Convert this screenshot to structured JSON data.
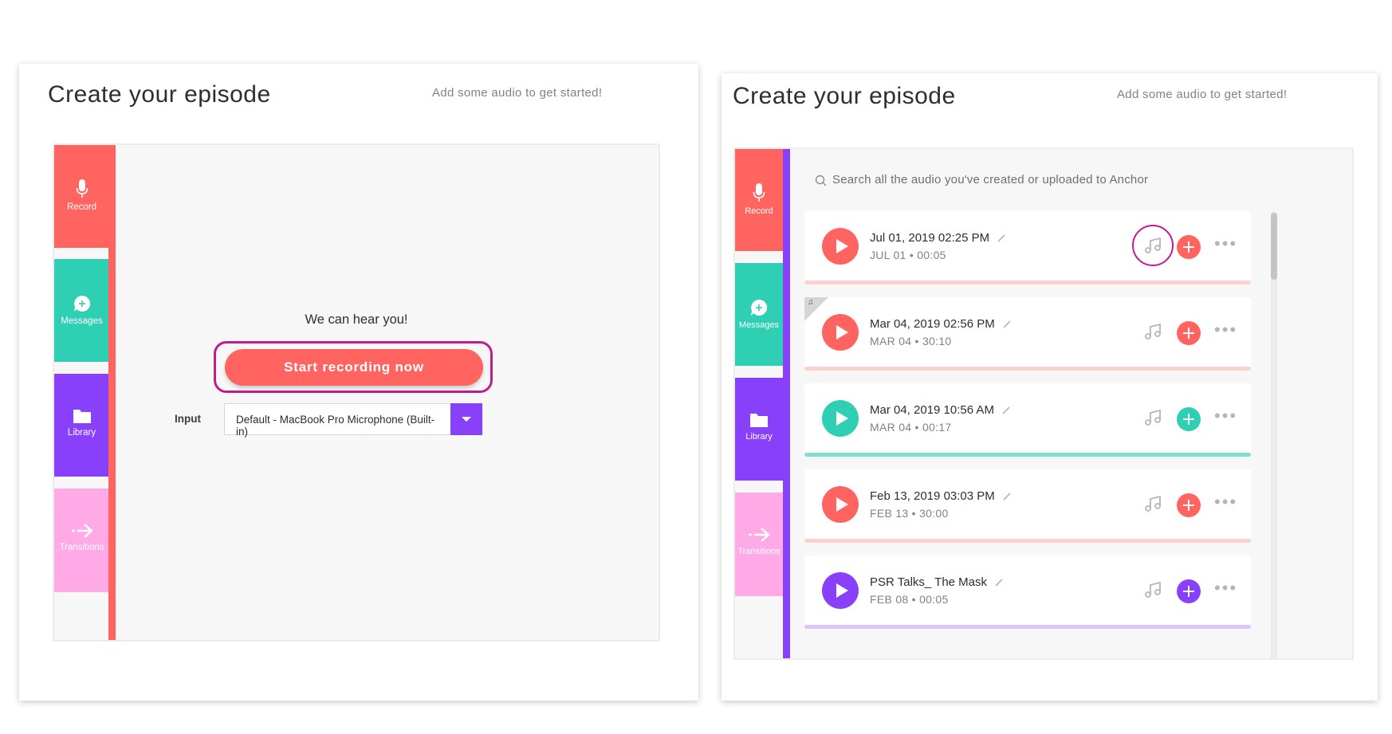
{
  "left_panel": {
    "title": "Create your episode",
    "subtitle": "Add some audio to get started!",
    "tabs": [
      {
        "label": "Record",
        "icon": "microphone-icon"
      },
      {
        "label": "Messages",
        "icon": "chat-plus-icon"
      },
      {
        "label": "Library",
        "icon": "folder-icon"
      },
      {
        "label": "Transitions",
        "icon": "arrow-right-icon"
      }
    ],
    "status_text": "We can hear you!",
    "record_button": "Start recording now",
    "input_label": "Input",
    "input_value": "Default - MacBook Pro Microphone (Built-in)"
  },
  "right_panel": {
    "title": "Create your episode",
    "subtitle": "Add some audio to get started!",
    "tabs": [
      {
        "label": "Record",
        "icon": "microphone-icon"
      },
      {
        "label": "Messages",
        "icon": "chat-plus-icon"
      },
      {
        "label": "Library",
        "icon": "folder-icon"
      },
      {
        "label": "Transitions",
        "icon": "arrow-right-icon"
      }
    ],
    "search_placeholder": "Search all the audio you've created or uploaded to Anchor",
    "items": [
      {
        "title": "Jul 01, 2019 02:25 PM",
        "meta": "JUL 01 • 00:05",
        "color": "#ff6461",
        "bar_color": "#fbd0cf"
      },
      {
        "title": "Mar 04, 2019 02:56 PM",
        "meta": "MAR 04 • 30:10",
        "color": "#ff6461",
        "bar_color": "#fbd0cf"
      },
      {
        "title": "Mar 04, 2019 10:56 AM",
        "meta": "MAR 04 • 00:17",
        "color": "#2ecfb3",
        "bar_color": "#7fdfcd"
      },
      {
        "title": "Feb 13, 2019 03:03 PM",
        "meta": "FEB 13 • 30:00",
        "color": "#ff6461",
        "bar_color": "#fbd0cf"
      },
      {
        "title": "PSR Talks_ The Mask",
        "meta": "FEB 08 • 00:05",
        "color": "#8940fa",
        "bar_color": "#d9c4fd"
      }
    ]
  },
  "colors": {
    "record": "#ff6461",
    "messages": "#2ecfb3",
    "library": "#8940fa",
    "transitions": "#ffaae6",
    "highlight": "#c01d8c"
  }
}
